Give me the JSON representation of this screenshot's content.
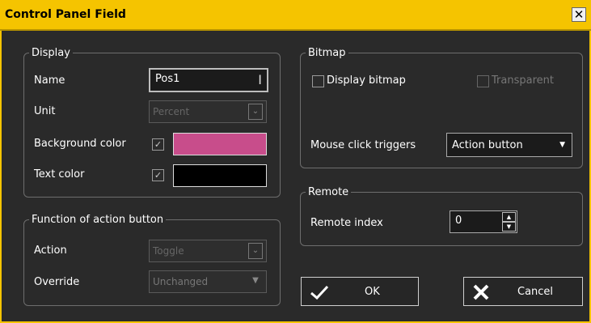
{
  "window": {
    "title": "Control Panel Field",
    "close_glyph": "✕"
  },
  "display": {
    "legend": "Display",
    "name_label": "Name",
    "name_value": "Pos1",
    "unit_label": "Unit",
    "unit_value": "Percent",
    "bg_label": "Background color",
    "bg_color": "#c84d8b",
    "text_label": "Text color",
    "text_color": "#000000"
  },
  "function": {
    "legend": "Function of action button",
    "action_label": "Action",
    "action_value": "Toggle",
    "override_label": "Override",
    "override_value": "Unchanged"
  },
  "bitmap": {
    "legend": "Bitmap",
    "display_bitmap_label": "Display bitmap",
    "transparent_label": "Transparent",
    "mouse_label": "Mouse click triggers",
    "mouse_value": "Action button"
  },
  "remote": {
    "legend": "Remote",
    "index_label": "Remote index",
    "index_value": "0"
  },
  "buttons": {
    "ok": "OK",
    "cancel": "Cancel"
  },
  "colors": {
    "accent": "#f5c400",
    "background": "#2a2a2a"
  }
}
